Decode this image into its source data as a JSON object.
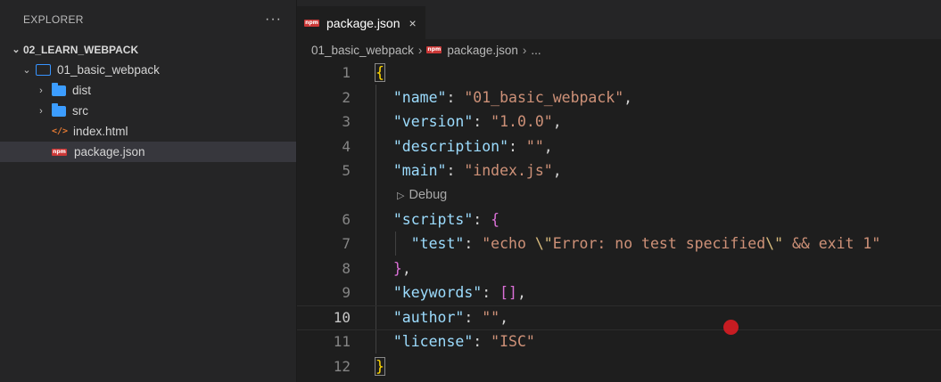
{
  "sidebar": {
    "title": "EXPLORER",
    "more": "···",
    "root": "02_LEARN_WEBPACK",
    "project": "01_basic_webpack",
    "items": [
      {
        "label": "dist",
        "type": "folder"
      },
      {
        "label": "src",
        "type": "folder"
      },
      {
        "label": "index.html",
        "type": "html"
      },
      {
        "label": "package.json",
        "type": "npm"
      }
    ],
    "html_glyph": "</>",
    "npm_glyph": "npm"
  },
  "tab": {
    "label": "package.json",
    "close": "×"
  },
  "breadcrumb": {
    "folder": "01_basic_webpack",
    "file": "package.json",
    "tail": "..."
  },
  "lens": {
    "label": "Debug"
  },
  "gutter": [
    "1",
    "2",
    "3",
    "4",
    "5",
    "6",
    "7",
    "8",
    "9",
    "10",
    "11",
    "12"
  ],
  "code": {
    "l1": "{",
    "l2k": "\"name\"",
    "l2v": "\"01_basic_webpack\"",
    "l3k": "\"version\"",
    "l3v": "\"1.0.0\"",
    "l4k": "\"description\"",
    "l4v": "\"\"",
    "l5k": "\"main\"",
    "l5v": "\"index.js\"",
    "l6k": "\"scripts\"",
    "l6b": "{",
    "l7k": "\"test\"",
    "l7a": "\"echo ",
    "l7e1": "\\\"",
    "l7m": "Error: no test specified",
    "l7e2": "\\\"",
    "l7b": " && exit 1\"",
    "l8": "}",
    "l9k": "\"keywords\"",
    "l9v": "[]",
    "l10k": "\"author\"",
    "l10v": "\"\"",
    "l11k": "\"license\"",
    "l11v": "\"ISC\"",
    "l12": "}"
  },
  "colors": {
    "accent": "#3794ff",
    "key": "#9cdcfe",
    "string": "#ce9178",
    "bracket": "#ffd700"
  }
}
